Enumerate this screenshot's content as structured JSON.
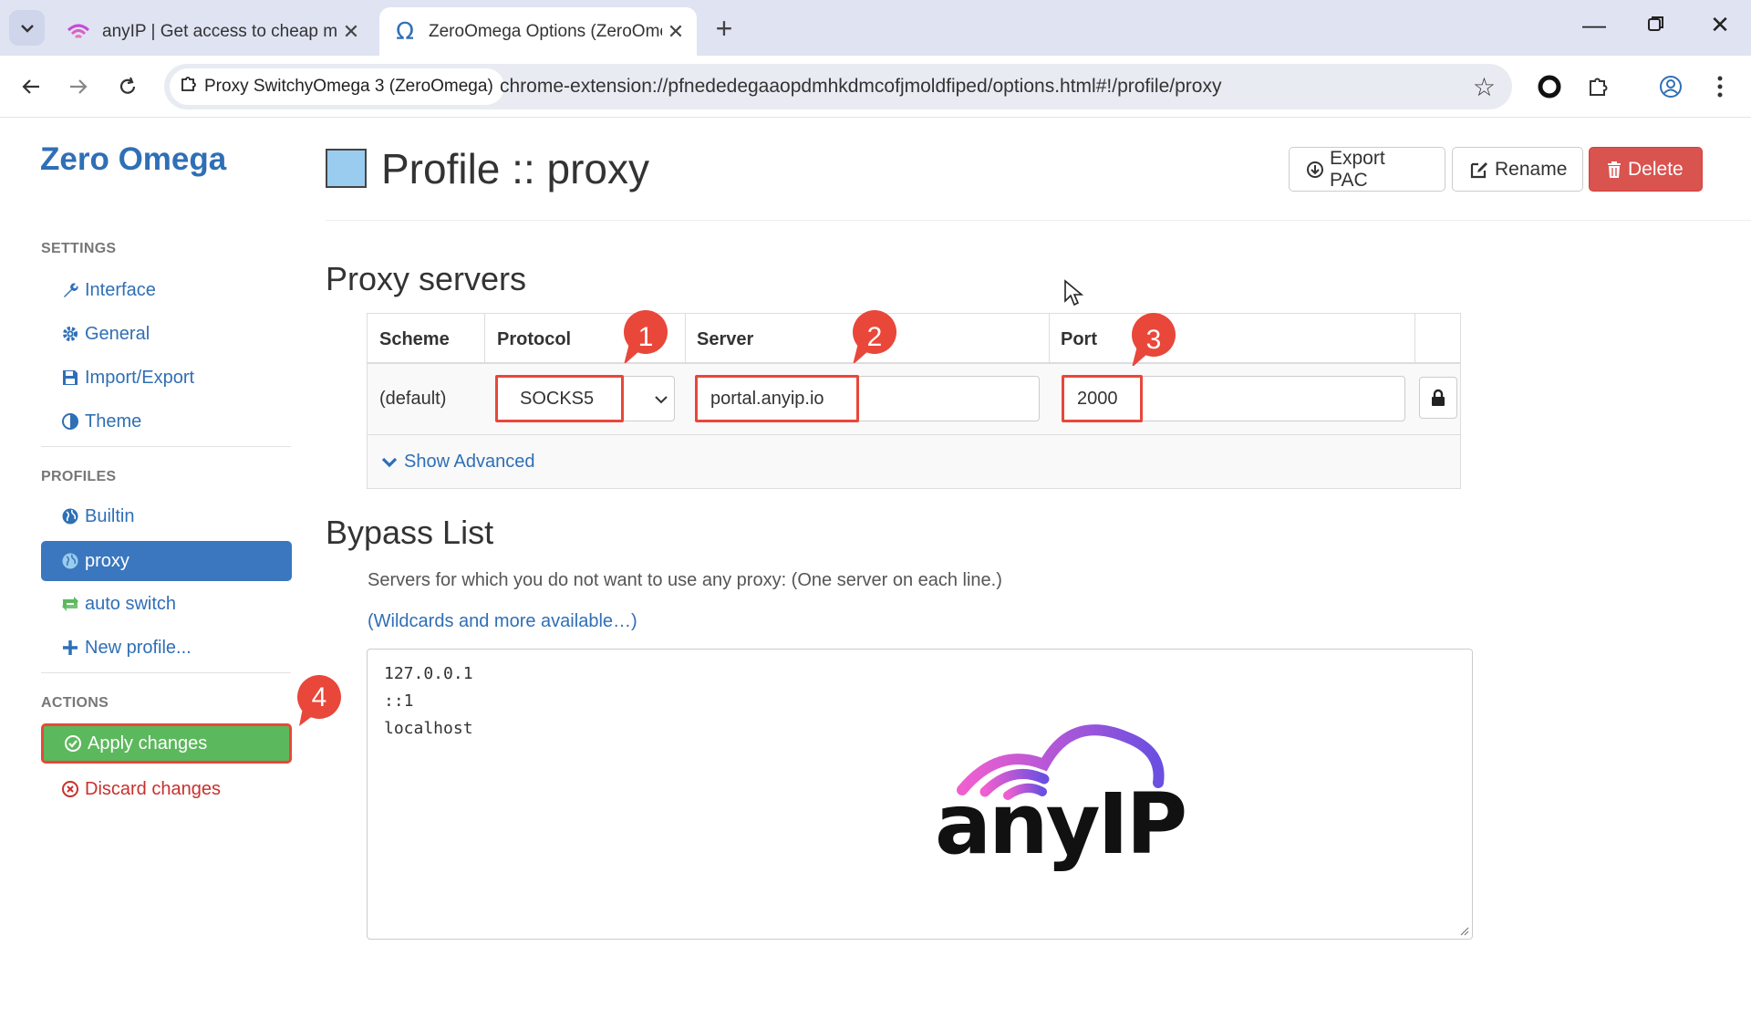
{
  "browser": {
    "tabs": [
      {
        "title": "anyIP | Get access to cheap mol",
        "active": false
      },
      {
        "title": "ZeroOmega Options (ZeroOme",
        "active": true
      }
    ],
    "site_chip": "Proxy SwitchyOmega 3 (ZeroOmega)",
    "url": "chrome-extension://pfnededegaaopdmhkdmcofjmoldfiped/options.html#!/profile/proxy"
  },
  "sidebar": {
    "brand": "Zero Omega",
    "settings_header": "SETTINGS",
    "settings_items": [
      {
        "label": "Interface",
        "icon": "wrench-icon"
      },
      {
        "label": "General",
        "icon": "gear-icon"
      },
      {
        "label": "Import/Export",
        "icon": "save-icon"
      },
      {
        "label": "Theme",
        "icon": "contrast-icon"
      }
    ],
    "profiles_header": "PROFILES",
    "profile_items": [
      {
        "label": "Builtin",
        "icon": "globe-icon"
      },
      {
        "label": "proxy",
        "icon": "globe-icon",
        "active": true
      },
      {
        "label": "auto switch",
        "icon": "retweet-icon"
      },
      {
        "label": "New profile...",
        "icon": "plus-icon"
      }
    ],
    "actions_header": "ACTIONS",
    "apply_label": "Apply changes",
    "discard_label": "Discard changes"
  },
  "header": {
    "title": "Profile :: proxy",
    "swatch_color": "#99ccee",
    "export_label": "Export PAC",
    "rename_label": "Rename",
    "delete_label": "Delete"
  },
  "proxy_servers": {
    "heading": "Proxy servers",
    "columns": [
      "Scheme",
      "Protocol",
      "Server",
      "Port"
    ],
    "row": {
      "scheme": "(default)",
      "protocol": "SOCKS5",
      "server": "portal.anyip.io",
      "port": "2000"
    },
    "show_advanced": "Show Advanced"
  },
  "bypass": {
    "heading": "Bypass List",
    "help": "Servers for which you do not want to use any proxy: (One server on each line.)",
    "link": "(Wildcards and more available…)",
    "lines": [
      "127.0.0.1",
      "::1",
      "localhost"
    ]
  },
  "annotations": {
    "badges": [
      "1",
      "2",
      "3",
      "4"
    ],
    "color": "#e8473a"
  },
  "watermark": {
    "text": "anyIP"
  }
}
